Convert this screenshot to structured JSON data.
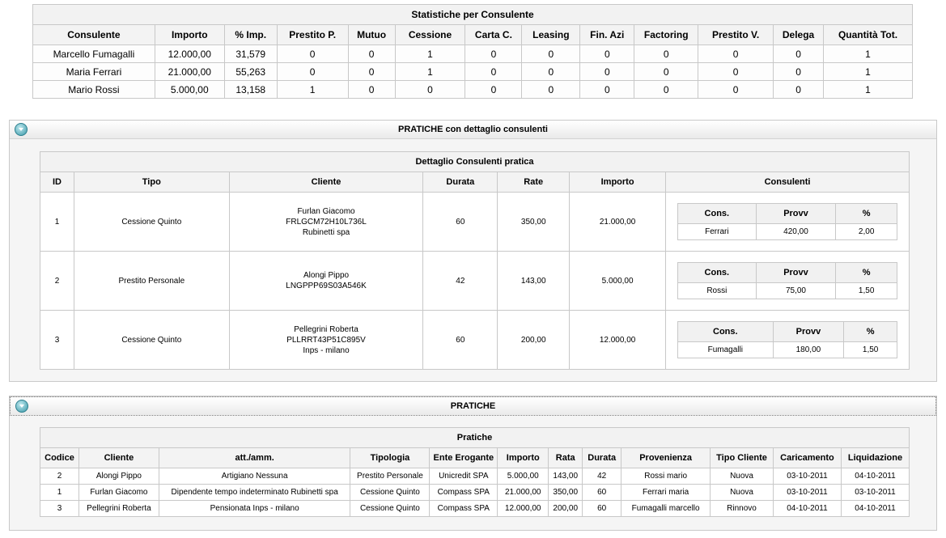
{
  "stats": {
    "title": "Statistiche per Consulente",
    "headers": [
      "Consulente",
      "Importo",
      "% Imp.",
      "Prestito P.",
      "Mutuo",
      "Cessione",
      "Carta C.",
      "Leasing",
      "Fin. Azi",
      "Factoring",
      "Prestito V.",
      "Delega",
      "Quantità Tot."
    ],
    "rows": [
      [
        "Marcello Fumagalli",
        "12.000,00",
        "31,579",
        "0",
        "0",
        "1",
        "0",
        "0",
        "0",
        "0",
        "0",
        "0",
        "1"
      ],
      [
        "Maria Ferrari",
        "21.000,00",
        "55,263",
        "0",
        "0",
        "1",
        "0",
        "0",
        "0",
        "0",
        "0",
        "0",
        "1"
      ],
      [
        "Mario Rossi",
        "5.000,00",
        "13,158",
        "1",
        "0",
        "0",
        "0",
        "0",
        "0",
        "0",
        "0",
        "0",
        "1"
      ]
    ]
  },
  "panel_dettaglio": {
    "header": "PRATICHE con dettaglio consulenti",
    "table_title": "Dettaglio Consulenti pratica",
    "headers": [
      "ID",
      "Tipo",
      "Cliente",
      "Durata",
      "Rate",
      "Importo",
      "Consulenti"
    ],
    "inner_headers": [
      "Cons.",
      "Provv",
      "%"
    ],
    "rows": [
      {
        "id": "1",
        "tipo": "Cessione Quinto",
        "cliente": [
          "Furlan Giacomo",
          "FRLGCM72H10L736L",
          "Rubinetti spa"
        ],
        "durata": "60",
        "rate": "350,00",
        "importo": "21.000,00",
        "consulenti": [
          [
            "Ferrari",
            "420,00",
            "2,00"
          ]
        ]
      },
      {
        "id": "2",
        "tipo": "Prestito Personale",
        "cliente": [
          "Alongi Pippo",
          "LNGPPP69S03A546K"
        ],
        "durata": "42",
        "rate": "143,00",
        "importo": "5.000,00",
        "consulenti": [
          [
            "Rossi",
            "75,00",
            "1,50"
          ]
        ]
      },
      {
        "id": "3",
        "tipo": "Cessione Quinto",
        "cliente": [
          "Pellegrini Roberta",
          "PLLRRT43P51C895V",
          "Inps - milano"
        ],
        "durata": "60",
        "rate": "200,00",
        "importo": "12.000,00",
        "consulenti": [
          [
            "Fumagalli",
            "180,00",
            "1,50"
          ]
        ]
      }
    ]
  },
  "panel_pratiche": {
    "header": "PRATICHE",
    "table_title": "Pratiche",
    "headers": [
      "Codice",
      "Cliente",
      "att./amm.",
      "Tipologia",
      "Ente Erogante",
      "Importo",
      "Rata",
      "Durata",
      "Provenienza",
      "Tipo Cliente",
      "Caricamento",
      "Liquidazione"
    ],
    "rows": [
      [
        "2",
        "Alongi Pippo",
        "Artigiano Nessuna",
        "Prestito Personale",
        "Unicredit SPA",
        "5.000,00",
        "143,00",
        "42",
        "Rossi mario",
        "Nuova",
        "03-10-2011",
        "04-10-2011"
      ],
      [
        "1",
        "Furlan Giacomo",
        "Dipendente tempo indeterminato Rubinetti spa",
        "Cessione Quinto",
        "Compass SPA",
        "21.000,00",
        "350,00",
        "60",
        "Ferrari maria",
        "Nuova",
        "03-10-2011",
        "03-10-2011"
      ],
      [
        "3",
        "Pellegrini Roberta",
        "Pensionata Inps - milano",
        "Cessione Quinto",
        "Compass SPA",
        "12.000,00",
        "200,00",
        "60",
        "Fumagalli marcello",
        "Rinnovo",
        "04-10-2011",
        "04-10-2011"
      ]
    ]
  }
}
